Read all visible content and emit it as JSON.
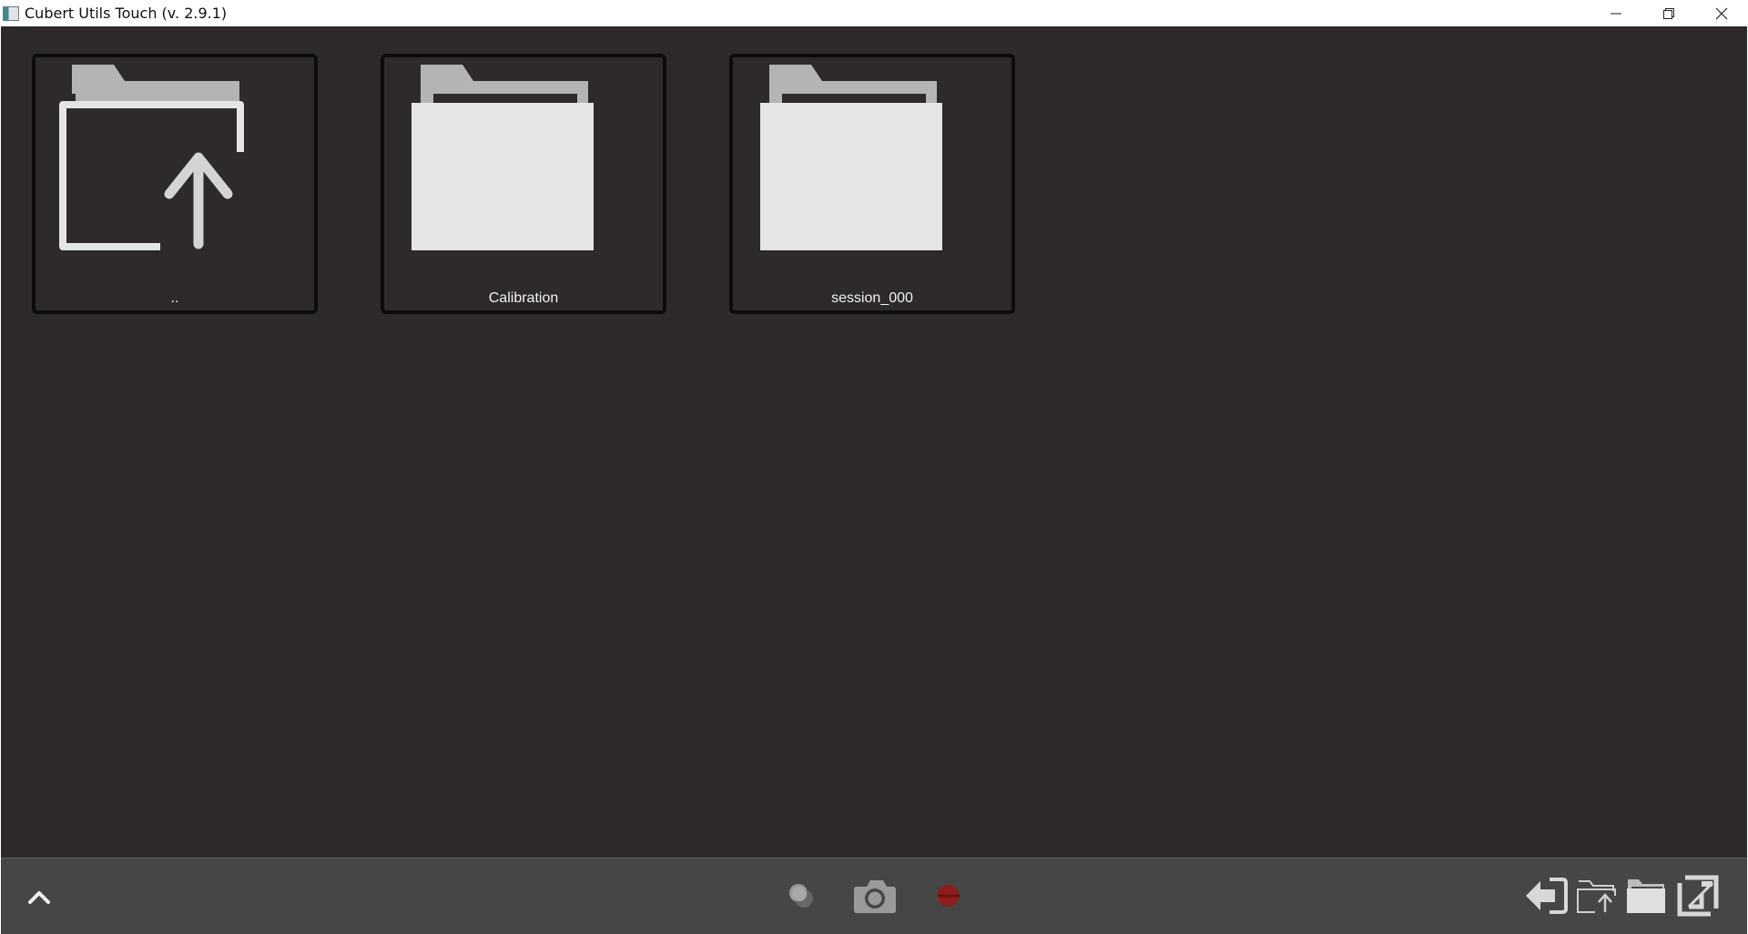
{
  "window": {
    "title": "Cubert Utils Touch (v. 2.9.1)"
  },
  "browser": {
    "items": [
      {
        "label": "..",
        "icon": "folder-up-icon"
      },
      {
        "label": "Calibration",
        "icon": "folder-icon"
      },
      {
        "label": "session_000",
        "icon": "folder-icon"
      }
    ]
  },
  "colors": {
    "background": "#2d2a29",
    "toolbar": "#464646",
    "icon_light": "#e4e5e4",
    "icon_dark": "#b4b4b4",
    "record_red": "#8e1c1c"
  },
  "toolbar": {
    "left": [
      "chevron-up-icon"
    ],
    "center": [
      "overlay-icon",
      "camera-icon",
      "record-icon"
    ],
    "right": [
      "exit-icon",
      "folder-up-icon",
      "folder-icon",
      "crop-icon"
    ]
  }
}
